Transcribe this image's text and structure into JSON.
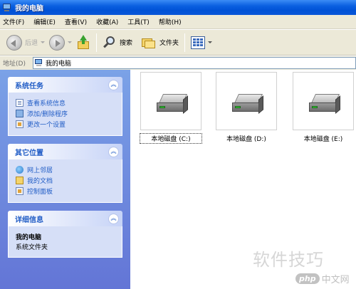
{
  "window": {
    "title": "我的电脑"
  },
  "menu": [
    "文件(F)",
    "编辑(E)",
    "查看(V)",
    "收藏(A)",
    "工具(T)",
    "帮助(H)"
  ],
  "toolbar": {
    "back_label": "后退",
    "search_label": "搜索",
    "folders_label": "文件夹"
  },
  "address": {
    "label": "地址(D)",
    "value": "我的电脑"
  },
  "panels": {
    "system_tasks": {
      "title": "系统任务",
      "items": [
        "查看系统信息",
        "添加/删除程序",
        "更改一个设置"
      ]
    },
    "other_places": {
      "title": "其它位置",
      "items": [
        "网上邻居",
        "我的文档",
        "控制面板"
      ]
    },
    "details": {
      "title": "详细信息",
      "name": "我的电脑",
      "sub": "系统文件夹"
    }
  },
  "drives": [
    "本地磁盘 (C:)",
    "本地磁盘 (D:)",
    "本地磁盘 (E:)"
  ],
  "watermark": {
    "text": "软件技巧",
    "logo_php": "php",
    "logo_cn": "中文网"
  }
}
